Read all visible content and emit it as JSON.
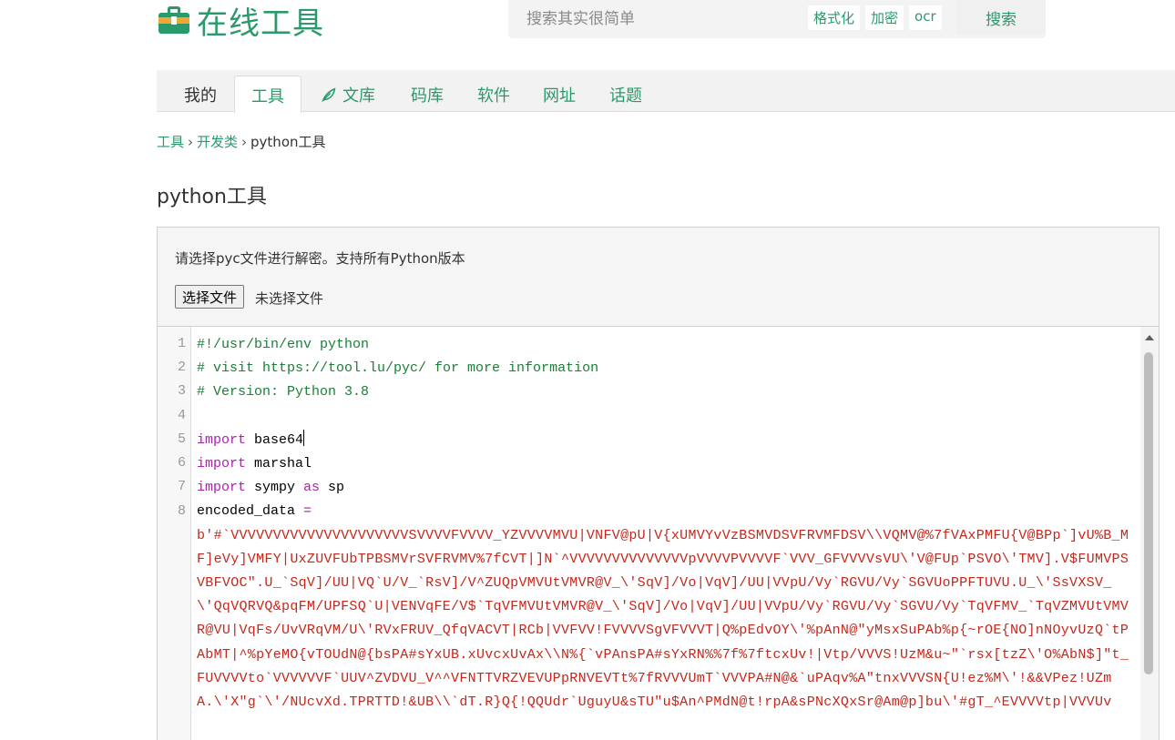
{
  "header": {
    "logo_text": "在线工具",
    "search": {
      "placeholder": "搜索其实很简单",
      "quick_tags": [
        "格式化",
        "加密",
        "ocr"
      ],
      "button_label": "搜索"
    }
  },
  "nav": {
    "items": [
      {
        "label": "我的"
      },
      {
        "label": "工具"
      },
      {
        "label": "文库"
      },
      {
        "label": "码库"
      },
      {
        "label": "软件"
      },
      {
        "label": "网址"
      },
      {
        "label": "话题"
      }
    ],
    "active": "工具"
  },
  "breadcrumb": {
    "items": [
      "工具",
      "开发类"
    ],
    "current": "python工具"
  },
  "page": {
    "title": "python工具",
    "instruction": "请选择pyc文件进行解密。支持所有Python版本",
    "file_button": "选择文件",
    "file_status": "未选择文件"
  },
  "editor": {
    "line_numbers": [
      "1",
      "2",
      "3",
      "4",
      "5",
      "6",
      "7",
      "8"
    ],
    "lines": {
      "l1": "#!/usr/bin/env python",
      "l2": "# visit https://tool.lu/pyc/ for more information",
      "l3": "# Version: Python 3.8",
      "l5_kw": "import",
      "l5_mod": " base64",
      "l6_kw": "import",
      "l6_mod": " marshal",
      "l7_kw": "import",
      "l7_mod": " sympy ",
      "l7_as": "as",
      "l7_alias": " sp",
      "l8_var": "encoded_data ",
      "l8_op": "=",
      "l8_value": "b'#`VVVVVVVVVVVVVVVVVVVVVSVVVVFVVVV_YZVVVVMVU|VNFV@pU|V{xUMVYvVzBSMVDSVFRVMFDSV\\\\VQMV@%7fVAxPMFU{V@BPp`]vU%B_MF]eVy]VMFY|UxZUVFUbTPBSMVrSVFRVMV%7fCVT|]N`^VVVVVVVVVVVVVVpVVVVPVVVVF`VVV_GFVVVVsVU\\'V@FUp`PSVO\\'TMV].V$FUMVPSVBFVOC\".U_`SqV]/UU|VQ`U/V_`RsV]/V^ZUQpVMVUtVMVR@V_\\'SqV]/Vo|VqV]/UU|VVpU/Vy`RGVU/Vy`SGVUoPPFTUVU.U_\\'SsVXSV_\\'QqVQRVQ&pqFM/UPFSQ`U|VENVqFE/V$`TqVFMVUtVMVR@V_\\'SqV]/Vo|VqV]/UU|VVpU/Vy`RGVU/Vy`SGVU/Vy`TqVFMV_`TqVZMVUtVMVR@VU|VqFs/UvVRqVM/U\\'RVxFRUV_QfqVACVT|RCb|VVFVV!FVVVVSgVFVVVT|Q%pEdvOY\\'%pAnN@\"yMsxSuPAb%p{~rOE{NO]nNOyvUzQ`tPAbMT|^%pYeMO{vTOUdN@{bsPA#sYxUB.xUvcxUvAx\\\\N%{`vPAnsPA#sYxRN%%7f%7ftcxUv!|Vtp/VVVS!UzM&u~\"`rsx[tzZ\\'O%AbN$]\"t_FUVVVVto`VVVVVVF`UUV^ZVDVU_V^^VFNTTVRZVEVUPpRNVEVTt%7fRVVVUmT`VVVPA#N@&`uPAqv%A\"tnxVVVSN{U!ez%M\\'!&&VPez!UZmA.\\'X\"g`\\'/NUcvXd.TPRTTD!&UB\\\\`dT.R}Q{!QQUdr`UguyU&sTU\"u$An^PMdN@t!rpA&sPNcXQxSr@Am@p]bu\\'#gT_^EVVVVtp|VVVUv"
    }
  }
}
